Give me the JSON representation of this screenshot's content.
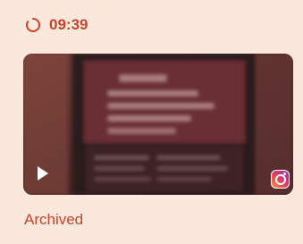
{
  "header": {
    "time": "09:39",
    "icon": "loading-circle-icon"
  },
  "media": {
    "type": "video",
    "play_icon": "play-icon",
    "source_icon": "instagram-icon"
  },
  "status": {
    "label": "Archived"
  },
  "colors": {
    "card_bg": "#fbe8dc",
    "accent": "#c8432a"
  }
}
